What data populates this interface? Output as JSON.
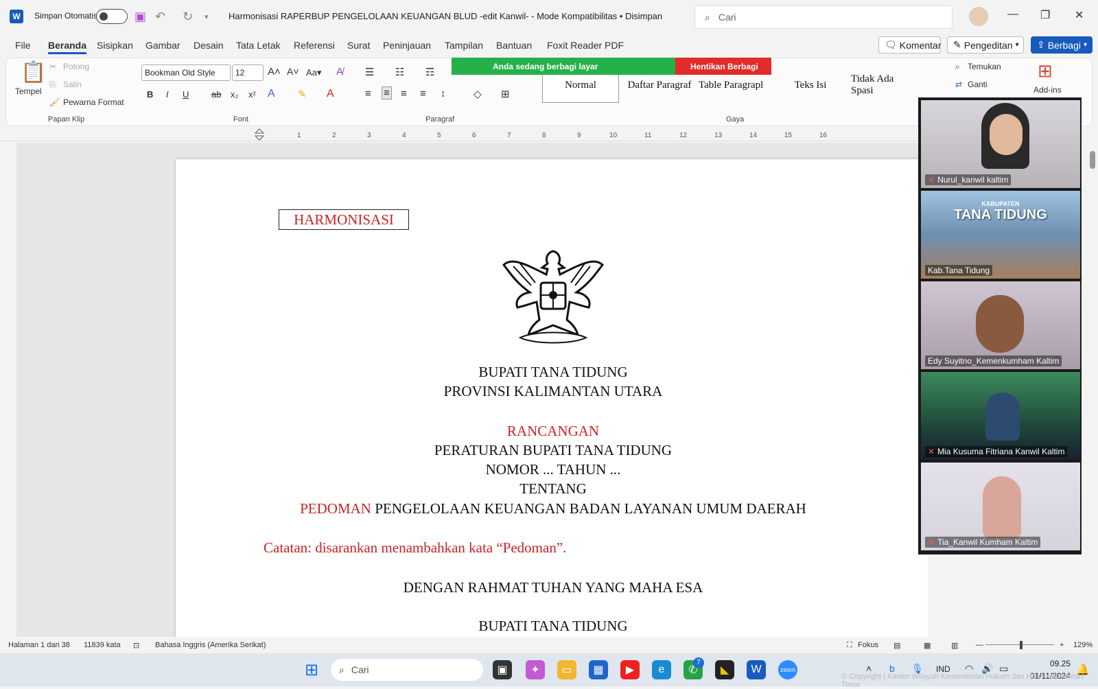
{
  "window": {
    "autosave_label": "Simpan Otomatis",
    "doc_title": "Harmonisasi RAPERBUP PENGELOLAAN KEUANGAN BLUD -edit Kanwil-  -  Mode Kompatibilitas • Disimpan",
    "search_placeholder": "Cari"
  },
  "menu": {
    "items": [
      "File",
      "Beranda",
      "Sisipkan",
      "Gambar",
      "Desain",
      "Tata Letak",
      "Referensi",
      "Surat",
      "Peninjauan",
      "Tampilan",
      "Bantuan",
      "Foxit Reader PDF"
    ],
    "active": "Beranda",
    "comment_label": "Komentar",
    "editing_label": "Pengeditan",
    "share_label": "Berbagi"
  },
  "ribbon": {
    "paste": "Tempel",
    "cut": "Potong",
    "copy": "Salin",
    "format_painter": "Pewarna Format",
    "clipboard_group": "Papan Klip",
    "font_name": "Bookman Old Style",
    "font_size": "12",
    "font_group": "Font",
    "paragraph_group": "Paragraf",
    "styles_group": "Gaya",
    "styles": [
      "Normal",
      "Daftar Paragraf",
      "Table Paragrapl",
      "Teks Isi",
      "Tidak Ada Spasi"
    ],
    "find": "Temukan",
    "replace": "Ganti",
    "addins": "Add-ins"
  },
  "sharing": {
    "status": "Anda sedang berbagi layar",
    "stop": "Hentikan Berbagi"
  },
  "document": {
    "tag": "HARMONISASI",
    "line1": "BUPATI TANA TIDUNG",
    "line2": "PROVINSI KALIMANTAN UTARA",
    "line3": "RANCANGAN",
    "line4": "PERATURAN BUPATI TANA TIDUNG",
    "line5": "NOMOR ... TAHUN ...",
    "line6": "TENTANG",
    "line7_red": "PEDOMAN",
    "line7_rest": " PENGELOLAAN KEUANGAN BADAN LAYANAN UMUM DAERAH",
    "note": "Catatan: disarankan menambahkan kata “Pedoman”.",
    "line8": "DENGAN RAHMAT TUHAN YANG MAHA ESA",
    "line9": "BUPATI TANA TIDUNG"
  },
  "participants": [
    {
      "name": "Nurul_kanwil kaltim",
      "muted": true,
      "speaking": false,
      "bg": "#b8b2b6"
    },
    {
      "name": "Kab.Tana Tidung",
      "muted": false,
      "speaking": true,
      "bg": "#6f8fb0",
      "banner": "TANA TIDUNG",
      "banner_small": "KABUPATEN"
    },
    {
      "name": "Edy Suyitno_Kemenkumham Kaltim",
      "muted": false,
      "speaking": false,
      "bg": "#a89da8"
    },
    {
      "name": "Mia Kusuma Fitriana Kanwil Kaltim",
      "muted": true,
      "speaking": false,
      "bg": "#1f4a3a"
    },
    {
      "name": "Tia_Kanwil Kumham Kaltim",
      "muted": true,
      "speaking": false,
      "bg": "#d6d3dc"
    }
  ],
  "status": {
    "page": "Halaman 1 dari 38",
    "words": "11839 kata",
    "language": "Bahasa Inggris (Amerika Serikat)",
    "focus": "Fokus",
    "zoom": "129%"
  },
  "taskbar": {
    "search": "Cari",
    "lang": "IND",
    "time": "09.25",
    "date": "01/11/2024",
    "whatsapp_badge": "7"
  },
  "watermark": "© Copyright | Kantor Wilayah Kementerian Hukum dan HAM Kalimantan Timur"
}
